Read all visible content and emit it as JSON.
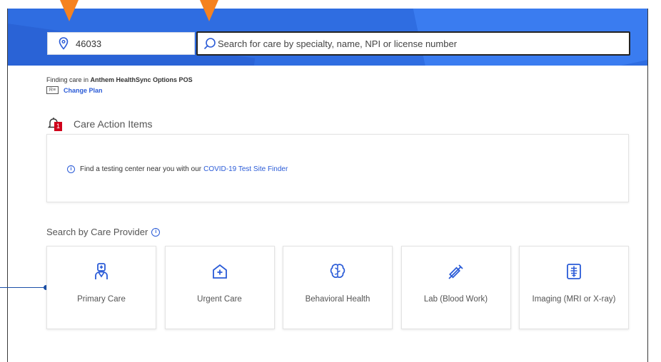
{
  "header": {
    "location": {
      "value": "46033",
      "icon": "map-pin-icon"
    },
    "search": {
      "placeholder": "Search for care by specialty, name, NPI or license number",
      "icon": "search-icon"
    },
    "accent_color": "#2f6de1"
  },
  "plan": {
    "prefix": "Finding care in ",
    "name": "Anthem HealthSync Options POS",
    "change_label": "Change Plan",
    "id_icon_text": "R≡"
  },
  "care_action": {
    "title": "Care Action Items",
    "badge_count": "1",
    "message": "Find a testing center near you with our ",
    "link": "COVID-19 Test Site Finder"
  },
  "care_provider": {
    "title": "Search by Care Provider",
    "tiles": [
      {
        "label": "Primary Care",
        "icon": "doctor-icon"
      },
      {
        "label": "Urgent Care",
        "icon": "urgent-care-icon"
      },
      {
        "label": "Behavioral Health",
        "icon": "brain-icon"
      },
      {
        "label": "Lab (Blood Work)",
        "icon": "syringe-icon"
      },
      {
        "label": "Imaging (MRI or X-ray)",
        "icon": "xray-icon"
      }
    ]
  },
  "colors": {
    "link": "#2a5bd7",
    "annotation_arrow": "#f58220",
    "badge": "#d0021b"
  }
}
